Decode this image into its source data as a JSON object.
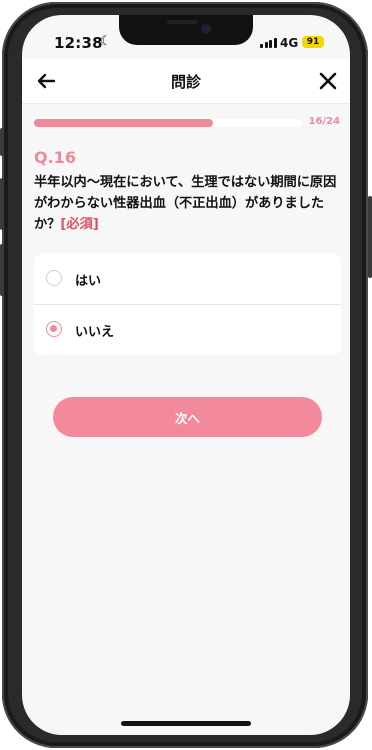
{
  "status_bar": {
    "time": "12:38",
    "moon_icon": "moon-icon",
    "network": "4G",
    "battery": "91"
  },
  "navbar": {
    "title": "問診",
    "back_icon": "arrow-left-icon",
    "close_icon": "close-icon"
  },
  "progress": {
    "current": 16,
    "total": 24,
    "label": "16/24",
    "fraction": 0.6667,
    "color": "#ef8a9b"
  },
  "question": {
    "number": "Q.16",
    "text": "半年以内〜現在において、生理ではない期間に原因がわからない性器出血（不正出血）がありましたか？",
    "required": "[必須]"
  },
  "options": [
    {
      "label": "はい",
      "selected": false
    },
    {
      "label": "いいえ",
      "selected": true
    }
  ],
  "next_button": {
    "label": "次へ",
    "color": "#f38a9c"
  }
}
